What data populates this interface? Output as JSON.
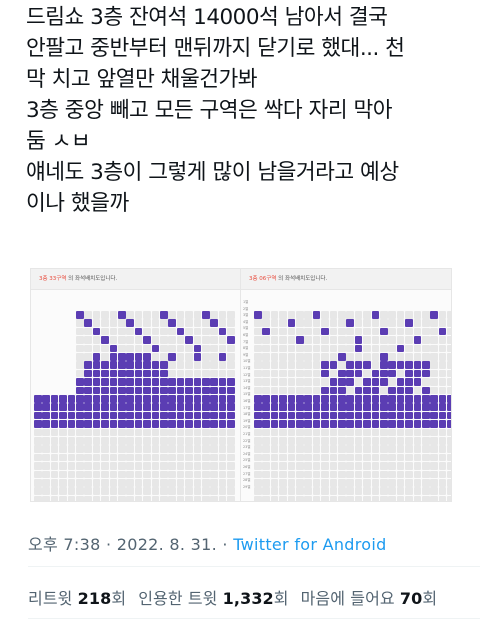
{
  "tweet": {
    "lines": [
      "드림쇼 3층 잔여석 14000석 남아서 결국",
      "안팔고 중반부터 맨뒤까지 닫기로 했대... 천",
      "막 치고 앞열만 채울건가봐",
      "3층 중앙 빼고 모든 구역은 싹다 자리 막아",
      "둠 ㅅㅂ",
      "얘네도 3층이 그렇게 많이 남을거라고 예상",
      "이나 했을까"
    ]
  },
  "seatmap_left": {
    "zone": "3층 33구역",
    "suffix": " 의 좌석배치도입니다."
  },
  "seatmap_right": {
    "zone": "3층 06구역",
    "suffix": " 의 좌석배치도입니다."
  },
  "row_labels": [
    "1열",
    "2열",
    "3열",
    "4열",
    "5열",
    "6열",
    "7열",
    "8열",
    "9열",
    "10열",
    "11열",
    "12열",
    "13열",
    "14열",
    "15열",
    "16열",
    "17열",
    "18열",
    "19열",
    "20열",
    "21열",
    "22열",
    "23열",
    "24열",
    "25열",
    "26열",
    "27열",
    "28열",
    "29열"
  ],
  "timestamp": {
    "time": "오후 7:38",
    "sep1": " · ",
    "date": "2022. 8. 31.",
    "sep2": " · ",
    "source": "Twitter for Android"
  },
  "stats": {
    "retweets_label": "리트윗 ",
    "retweets_count": "218",
    "retweets_unit": "회",
    "quotes_label": "인용한 트윗 ",
    "quotes_count": "1,332",
    "quotes_unit": "회",
    "likes_label": "마음에 들어요 ",
    "likes_count": "70",
    "likes_unit": "회"
  },
  "colors": {
    "available_seat": "#5b3db3",
    "closed_seat": "#e7e7e7",
    "link": "#1d9bf0"
  }
}
